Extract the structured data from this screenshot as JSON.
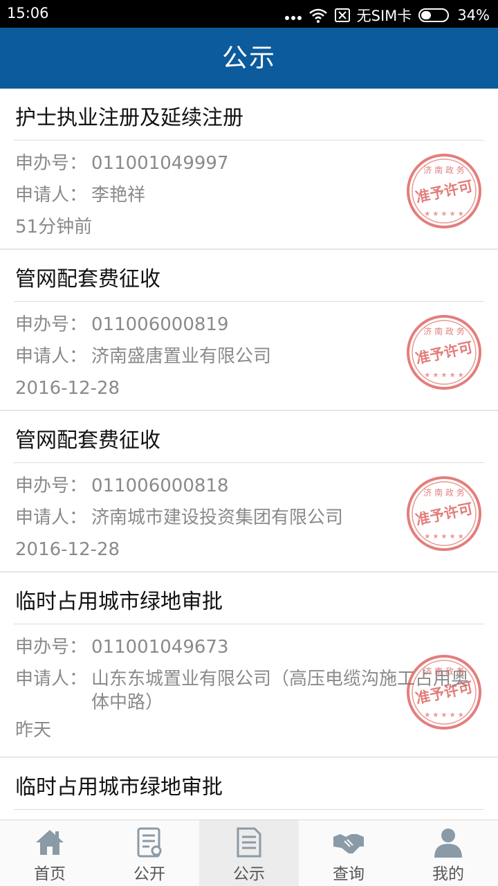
{
  "status": {
    "time": "15:06",
    "carrier": "无SIM卡",
    "battery": "34%"
  },
  "header": {
    "title": "公示"
  },
  "labels": {
    "number": "申办号：",
    "applicant": "申请人：",
    "stamp_top": "济 南 政 务",
    "stamp_main": "准予许可"
  },
  "items": [
    {
      "title": "护士执业注册及延续注册",
      "number": "011001049997",
      "applicant": "李艳祥",
      "time": "51分钟前"
    },
    {
      "title": "管网配套费征收",
      "number": "011006000819",
      "applicant": "济南盛唐置业有限公司",
      "time": "2016-12-28"
    },
    {
      "title": "管网配套费征收",
      "number": "011006000818",
      "applicant": "济南城市建设投资集团有限公司",
      "time": "2016-12-28"
    },
    {
      "title": "临时占用城市绿地审批",
      "number": "011001049673",
      "applicant": "山东东城置业有限公司（高压电缆沟施工占用奥体中路）",
      "time": "昨天"
    },
    {
      "title": "临时占用城市绿地审批"
    }
  ],
  "tabs": [
    {
      "label": "首页",
      "icon": "home-icon"
    },
    {
      "label": "公开",
      "icon": "document-icon"
    },
    {
      "label": "公示",
      "icon": "notice-icon",
      "active": true
    },
    {
      "label": "查询",
      "icon": "handshake-icon"
    },
    {
      "label": "我的",
      "icon": "user-icon"
    }
  ],
  "colors": {
    "header": "#0c5b9c",
    "stamp": "#d9534f",
    "status_bar": "#000000"
  }
}
